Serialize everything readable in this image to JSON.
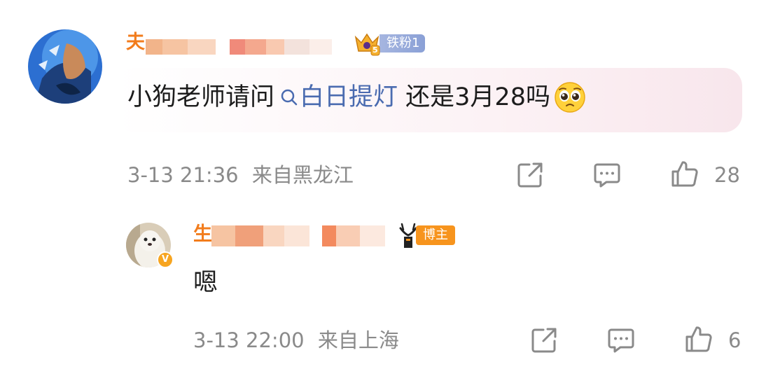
{
  "comment": {
    "text": "小狗老师请问",
    "topic_link": "白日提灯",
    "text_after": " 还是3月28吗",
    "time": "3-13 21:36",
    "location": "来自黑龙江",
    "like_count": "28",
    "username_visible_initial": "夫",
    "fan_badge": {
      "level": "5",
      "label": "铁粉1"
    }
  },
  "reply": {
    "text": "嗯",
    "time": "3-13 22:00",
    "location": "来自上海",
    "like_count": "6",
    "username_visible_initial": "生",
    "blogger_badge": "博主",
    "verified_mark": "V"
  },
  "icons": [
    "share-icon",
    "comment-icon",
    "like-icon",
    "search-icon",
    "pleading-face-emoji"
  ],
  "colors": {
    "username": "#f27c1c",
    "topic_link": "#4a6bb0",
    "meta_gray": "#8a8a8a",
    "blogger_badge": "#f7941d",
    "fan_badge": "#8aa0d6"
  }
}
